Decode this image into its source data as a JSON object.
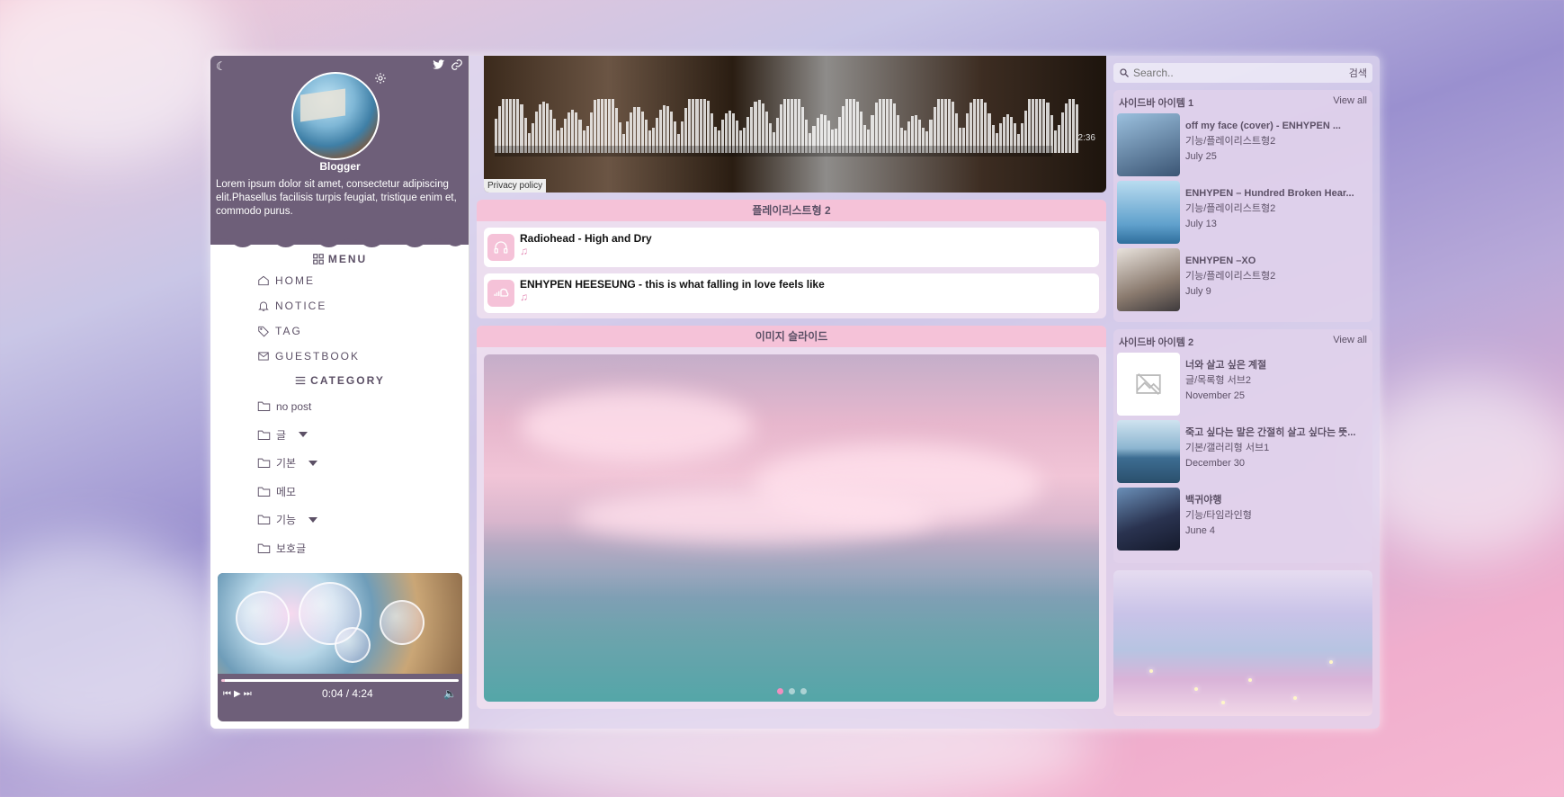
{
  "profile": {
    "name": "Blogger",
    "description": "Lorem ipsum dolor sit amet, consectetur adipiscing elit.Phasellus facilisis turpis feugiat, tristique enim et, commodo purus."
  },
  "menu": {
    "title": "MENU",
    "items": [
      {
        "label": "HOME",
        "icon": "home-icon"
      },
      {
        "label": "NOTICE",
        "icon": "bell-icon"
      },
      {
        "label": "TAG",
        "icon": "tag-icon"
      },
      {
        "label": "GUESTBOOK",
        "icon": "mail-icon"
      }
    ]
  },
  "category": {
    "title": "CATEGORY",
    "items": [
      {
        "label": "no post",
        "expandable": false
      },
      {
        "label": "글",
        "expandable": true
      },
      {
        "label": "기본",
        "expandable": true
      },
      {
        "label": "메모",
        "expandable": false
      },
      {
        "label": "기능",
        "expandable": true
      },
      {
        "label": "보호글",
        "expandable": false
      }
    ]
  },
  "music_player": {
    "time": "0:04 / 4:24",
    "progress": 0.015
  },
  "video": {
    "duration": "2:36",
    "privacy": "Privacy policy"
  },
  "playlist": {
    "title": "플레이리스트형 2",
    "items": [
      {
        "title": "Radiohead - High and Dry",
        "icon": "headphones-icon"
      },
      {
        "title": "ENHYPEN HEESEUNG - this is what falling in love feels like",
        "icon": "soundcloud-icon"
      }
    ]
  },
  "slider": {
    "title": "이미지 슬라이드",
    "active_index": 0,
    "count": 3
  },
  "search": {
    "placeholder": "Search..",
    "button": "검색"
  },
  "sidebar1": {
    "title": "사이드바 아이템 1",
    "view_all": "View all",
    "items": [
      {
        "title": "off my face (cover) - ENHYPEN ...",
        "category": "기능/플레이리스트형2",
        "date": "July 25",
        "color": "#5a7fa8"
      },
      {
        "title": "ENHYPEN – Hundred Broken Hear...",
        "category": "기능/플레이리스트형2",
        "date": "July 13",
        "color": "#7eb7d8"
      },
      {
        "title": "ENHYPEN –XO",
        "category": "기능/플레이리스트형2",
        "date": "July 9",
        "color": "#b9a89a"
      }
    ]
  },
  "sidebar2": {
    "title": "사이드바 아이템 2",
    "view_all": "View all",
    "items": [
      {
        "title": "너와 살고 싶은 계절",
        "category": "글/목록형 서브2",
        "date": "November 25",
        "color": "#ffffff"
      },
      {
        "title": "죽고 싶다는 말은 간절히 살고 싶다는 뜻...",
        "category": "기본/갤러리형 서브1",
        "date": "December 30",
        "color": "#5e8fb5"
      },
      {
        "title": "백귀야행",
        "category": "기능/타임라인형",
        "date": "June 4",
        "color": "#3d4a6a"
      }
    ]
  }
}
